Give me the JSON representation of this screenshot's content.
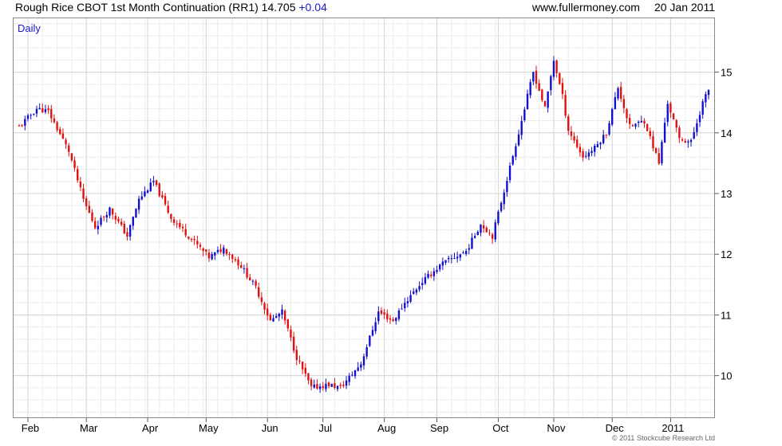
{
  "header": {
    "instrument": "Rough Rice CBOT 1st Month Continuation (RR1) 14.705",
    "change": "+0.04",
    "website": "www.fullermoney.com",
    "date": "20 Jan 2011"
  },
  "footer": {
    "copyright": "© 2011 Stockcube Research Ltd"
  },
  "colors": {
    "up": "#1010cc",
    "down": "#e01010",
    "grid": "#d4d4d4",
    "frame": "#888888"
  },
  "chart_data": {
    "type": "candlestick",
    "interval_label": "Daily",
    "y_axis_side": "right",
    "ylim": [
      9.3,
      15.9
    ],
    "y_ticks": [
      10,
      11,
      12,
      13,
      14,
      15
    ],
    "x_month_labels": [
      "Feb",
      "Mar",
      "Apr",
      "May",
      "Jun",
      "Jul",
      "Aug",
      "Sep",
      "Oct",
      "Nov",
      "Dec",
      "2011"
    ],
    "x_month_positions": [
      3,
      23,
      44,
      64,
      85,
      104,
      125,
      143,
      164,
      183,
      203,
      223
    ],
    "n_bars": 237,
    "grid": true,
    "close_path_keypoints": [
      [
        0,
        14.1
      ],
      [
        6,
        14.4
      ],
      [
        10,
        14.35
      ],
      [
        17,
        13.7
      ],
      [
        22,
        12.9
      ],
      [
        26,
        12.45
      ],
      [
        31,
        12.75
      ],
      [
        37,
        12.3
      ],
      [
        41,
        12.9
      ],
      [
        46,
        13.2
      ],
      [
        52,
        12.6
      ],
      [
        58,
        12.3
      ],
      [
        65,
        11.95
      ],
      [
        70,
        12.1
      ],
      [
        76,
        11.8
      ],
      [
        81,
        11.45
      ],
      [
        86,
        10.9
      ],
      [
        90,
        11.05
      ],
      [
        95,
        10.3
      ],
      [
        100,
        9.8
      ],
      [
        106,
        9.85
      ],
      [
        110,
        9.8
      ],
      [
        117,
        10.2
      ],
      [
        123,
        11.05
      ],
      [
        128,
        10.9
      ],
      [
        132,
        11.2
      ],
      [
        138,
        11.55
      ],
      [
        145,
        11.85
      ],
      [
        153,
        12.05
      ],
      [
        158,
        12.5
      ],
      [
        162,
        12.3
      ],
      [
        166,
        13.05
      ],
      [
        172,
        14.2
      ],
      [
        176,
        15.0
      ],
      [
        180,
        14.4
      ],
      [
        183,
        15.2
      ],
      [
        186,
        14.6
      ],
      [
        188,
        14.05
      ],
      [
        193,
        13.6
      ],
      [
        197,
        13.75
      ],
      [
        201,
        14.0
      ],
      [
        205,
        14.75
      ],
      [
        209,
        14.1
      ],
      [
        214,
        14.2
      ],
      [
        219,
        13.5
      ],
      [
        222,
        14.5
      ],
      [
        226,
        13.9
      ],
      [
        230,
        13.85
      ],
      [
        234,
        14.5
      ],
      [
        236,
        14.705
      ]
    ]
  }
}
